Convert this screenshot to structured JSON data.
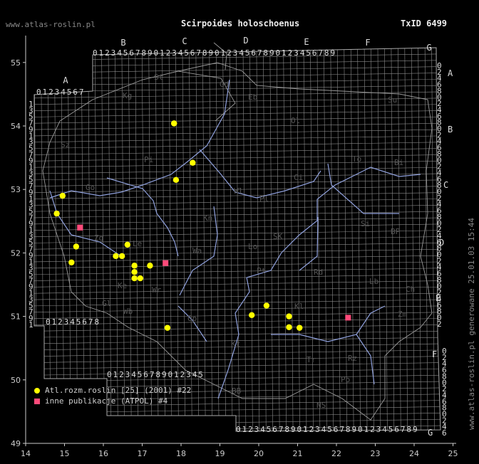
{
  "header": {
    "site": "www.atlas-roslin.pl",
    "title": "Scirpoides holoschoenus",
    "taxid": "TxID 6499"
  },
  "footer_vertical": "www.atlas-roslin.pl generowane 25.01.03 15:44",
  "colors": {
    "background": "#000000",
    "grid": "#8a8a8a",
    "border": "#9a9a9a",
    "rivers": "#8fa0dc",
    "axis": "#cccccc",
    "region_labels": "#555555",
    "atlas_dot": "#ffff00",
    "publication_marker": "#ff4a7a"
  },
  "chart_data": {
    "type": "scatter",
    "xlim": [
      14,
      25
    ],
    "ylim": [
      49,
      55.5
    ],
    "x_ticks": [
      "14",
      "15",
      "16",
      "17",
      "18",
      "19",
      "20",
      "21",
      "22",
      "23",
      "24",
      "25"
    ],
    "y_ticks": [
      "49",
      "50",
      "51",
      "52",
      "53",
      "54",
      "55"
    ],
    "grid_columns": [
      "A",
      "B",
      "C",
      "D",
      "E",
      "F",
      "G"
    ],
    "grid_rows": [
      "A",
      "B",
      "C",
      "D",
      "E",
      "F",
      "G"
    ],
    "region_labels": [
      "Kg",
      "St",
      "Gd",
      "Eb",
      "Su",
      "Sz",
      "Ol",
      "Pi",
      "Bi",
      "Go",
      "Ci",
      "To",
      "Wl",
      "Pl",
      "Si",
      "Kn",
      "Wa",
      "Zg",
      "Le",
      "SK",
      "BP",
      "Lo",
      "Pt",
      "Rd",
      "Lb",
      "Ch",
      "Wr",
      "Ke",
      "Op",
      "Kl",
      "Zm",
      "Wb",
      "Gl",
      "Kt",
      "Tr",
      "Rz",
      "BB",
      "NS",
      "Po"
    ],
    "series": [
      {
        "name": "Atl.rozm.roslin [25] (2001) #22",
        "marker": "circle",
        "points": [
          [
            17.82,
            54.04
          ],
          [
            18.3,
            53.42
          ],
          [
            17.87,
            53.15
          ],
          [
            14.95,
            52.9
          ],
          [
            14.8,
            52.62
          ],
          [
            15.3,
            52.1
          ],
          [
            15.18,
            51.85
          ],
          [
            16.32,
            51.95
          ],
          [
            16.48,
            51.95
          ],
          [
            16.62,
            52.13
          ],
          [
            16.8,
            51.8
          ],
          [
            16.8,
            51.7
          ],
          [
            16.8,
            51.6
          ],
          [
            16.95,
            51.6
          ],
          [
            17.2,
            51.8
          ],
          [
            17.65,
            50.82
          ],
          [
            19.82,
            51.02
          ],
          [
            20.2,
            51.17
          ],
          [
            20.78,
            51.0
          ],
          [
            20.78,
            50.83
          ],
          [
            21.05,
            50.82
          ],
          [
            17.82,
            54.04
          ]
        ]
      },
      {
        "name": "inne publikacje (ATPOL) #4",
        "marker": "square",
        "points": [
          [
            15.4,
            52.4
          ],
          [
            17.6,
            51.84
          ],
          [
            22.3,
            50.98
          ],
          [
            15.4,
            52.4
          ]
        ]
      }
    ]
  }
}
